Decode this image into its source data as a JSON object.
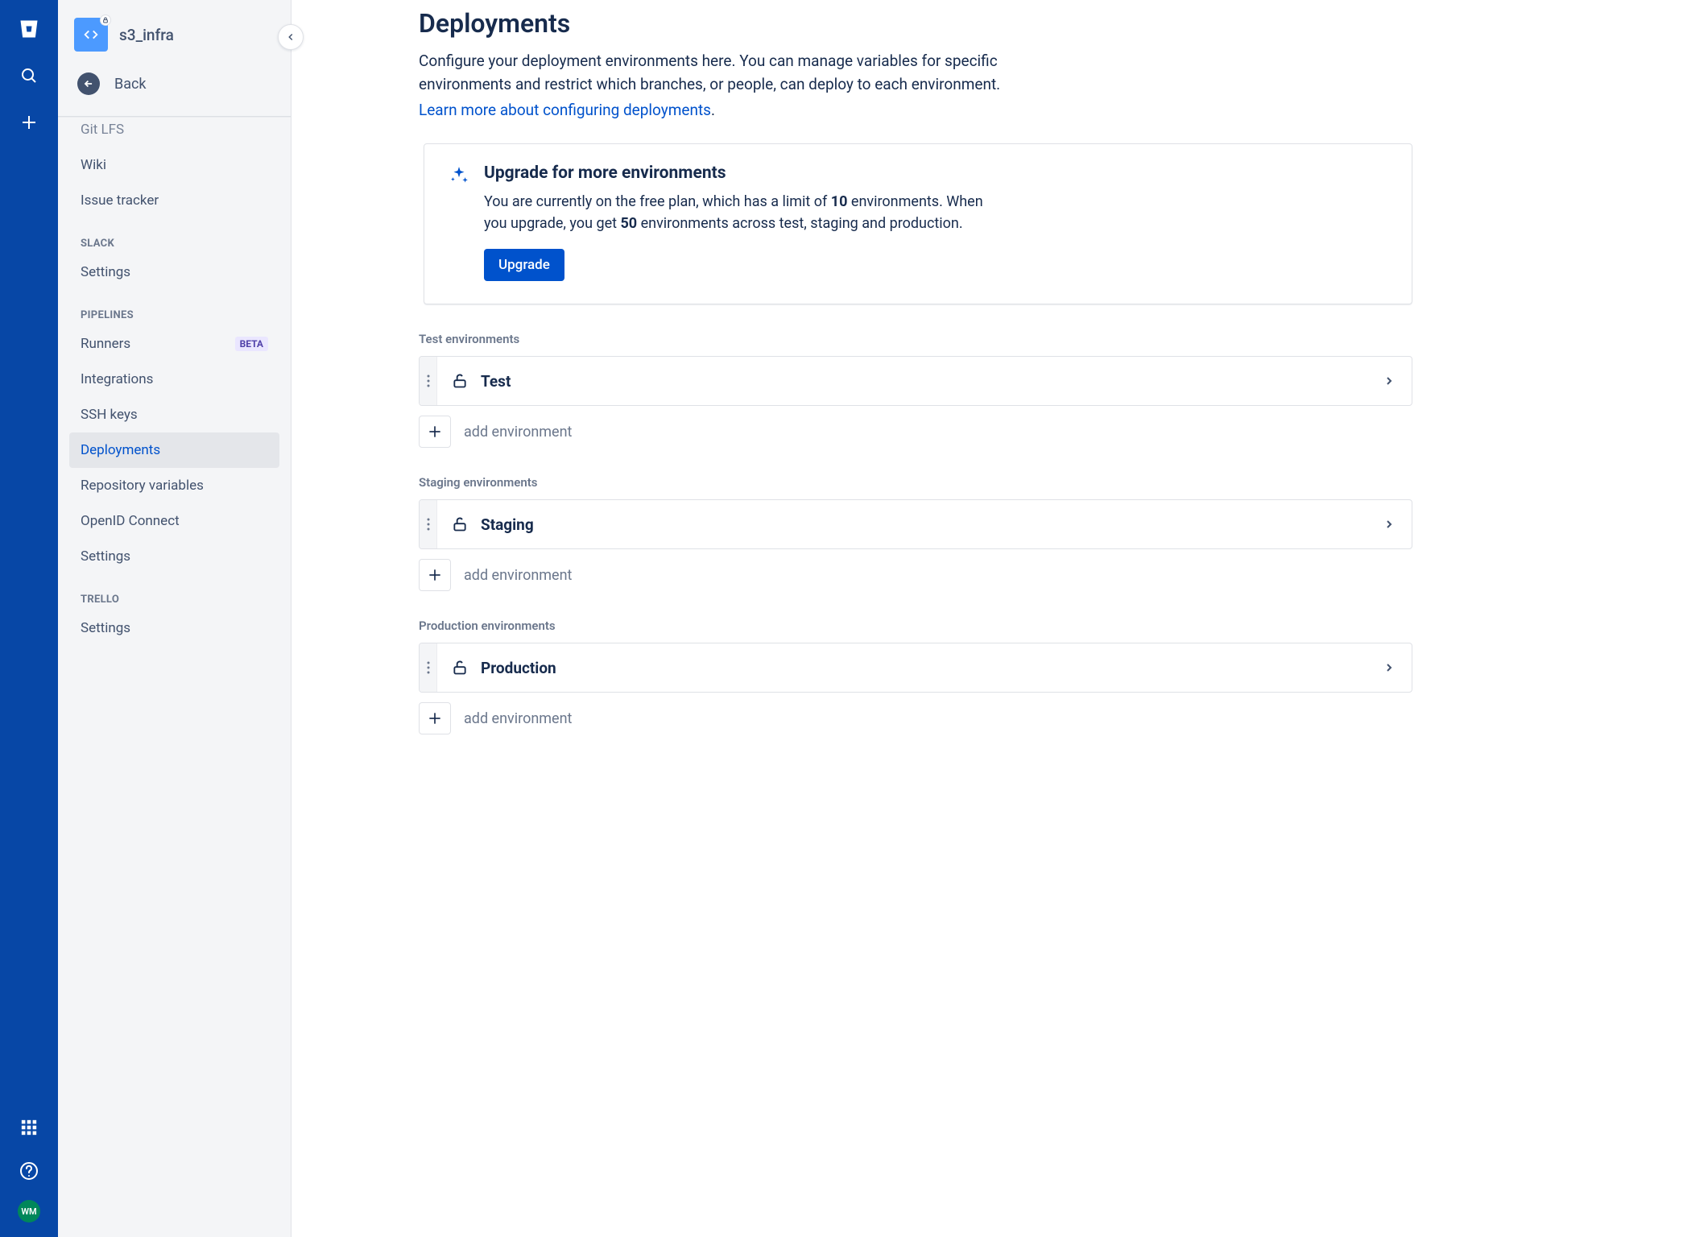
{
  "rail": {
    "avatar_initials": "WM"
  },
  "sidebar": {
    "repo_name": "s3_infra",
    "back_label": "Back",
    "items_top": [
      {
        "label": "Git LFS"
      },
      {
        "label": "Wiki"
      },
      {
        "label": "Issue tracker"
      }
    ],
    "slack_heading": "SLACK",
    "slack_items": [
      {
        "label": "Settings"
      }
    ],
    "pipelines_heading": "PIPELINES",
    "pipelines_items": [
      {
        "label": "Runners",
        "badge": "BETA"
      },
      {
        "label": "Integrations"
      },
      {
        "label": "SSH keys"
      },
      {
        "label": "Deployments",
        "active": true
      },
      {
        "label": "Repository variables"
      },
      {
        "label": "OpenID Connect"
      },
      {
        "label": "Settings"
      }
    ],
    "trello_heading": "TRELLO",
    "trello_items": [
      {
        "label": "Settings"
      }
    ]
  },
  "main": {
    "title": "Deployments",
    "description": "Configure your deployment environments here. You can manage variables for specific environments and restrict which branches, or people, can deploy to each environment.",
    "learn_link": "Learn more about configuring deployments",
    "upgrade": {
      "title": "Upgrade for more environments",
      "body_1": "You are currently on the free plan, which has a limit of ",
      "body_bold1": "10",
      "body_2": " environments. When you upgrade, you get ",
      "body_bold2": "50",
      "body_3": " environments across test, staging and production.",
      "button": "Upgrade"
    },
    "sections": [
      {
        "heading": "Test environments",
        "env_name": "Test",
        "add_label": "add environment"
      },
      {
        "heading": "Staging environments",
        "env_name": "Staging",
        "add_label": "add environment"
      },
      {
        "heading": "Production environments",
        "env_name": "Production",
        "add_label": "add environment"
      }
    ]
  }
}
